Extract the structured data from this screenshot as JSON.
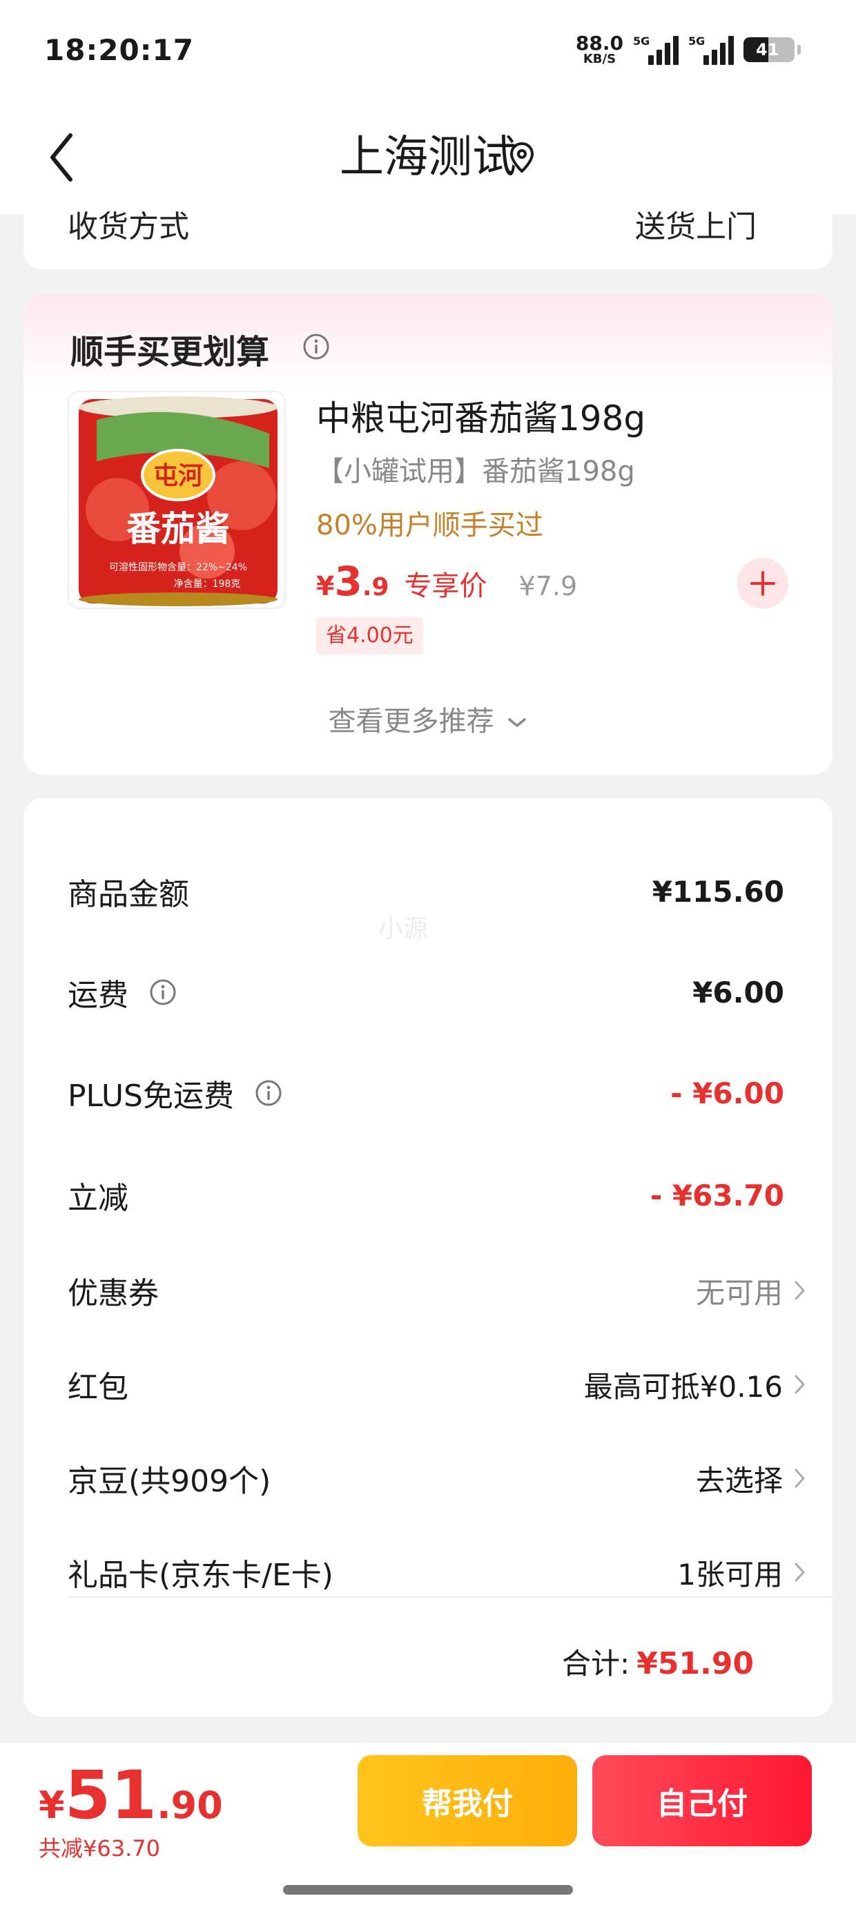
{
  "status_bar": {
    "time": "18:20:17",
    "net_speed_value": "88.0",
    "net_speed_unit": "KB/S",
    "signal_tag_1": "5G",
    "signal_tag_2": "5G",
    "battery": "41"
  },
  "nav": {
    "title": "上海测试",
    "back_icon": "back-arrow-icon",
    "location_icon": "location-pin-icon"
  },
  "top_card": {
    "left_text": "收货方式",
    "right_text": "送货上门"
  },
  "recommend": {
    "title": "顺手买更划算",
    "product": {
      "name": "中粮屯河番茄酱198g",
      "subtitle": "【小罐试用】番茄酱198g",
      "hint": "80%用户顺手买过",
      "currency": "¥",
      "price_int": "3",
      "price_dec": ".9",
      "price_label": "专享价",
      "original_price": "¥7.9",
      "saving": "省4.00元",
      "can_brand": "屯河",
      "can_text": "番茄酱",
      "can_detail": "可溶性固形物含量：22%~24%",
      "can_weight": "净含量：198克"
    },
    "more": "查看更多推荐"
  },
  "summary": {
    "rows": [
      {
        "label": "商品金额",
        "value": "¥115.60"
      },
      {
        "label": "运费",
        "value": "¥6.00"
      },
      {
        "label": "PLUS免运费",
        "value": "- ¥6.00"
      },
      {
        "label": "立减",
        "value": "- ¥63.70"
      },
      {
        "label": "优惠券",
        "value": "无可用"
      },
      {
        "label": "红包",
        "value": "最高可抵¥0.16"
      },
      {
        "label": "京豆(共909个)",
        "value": "去选择"
      },
      {
        "label": "礼品卡(京东卡/E卡)",
        "value": "1张可用"
      }
    ],
    "total_label": "合计:",
    "total_value": "¥51.90"
  },
  "watermark": "小源",
  "bottom": {
    "currency": "¥",
    "amount_int": "51",
    "amount_dec": ".90",
    "saved": "共减¥63.70",
    "helper_button": "帮我付",
    "self_button": "自己付"
  },
  "colors": {
    "accent_red": "#e8302e",
    "hint_orange": "#c5812a",
    "helper_yellow": "#ffb812",
    "self_red": "#ff2a40"
  }
}
